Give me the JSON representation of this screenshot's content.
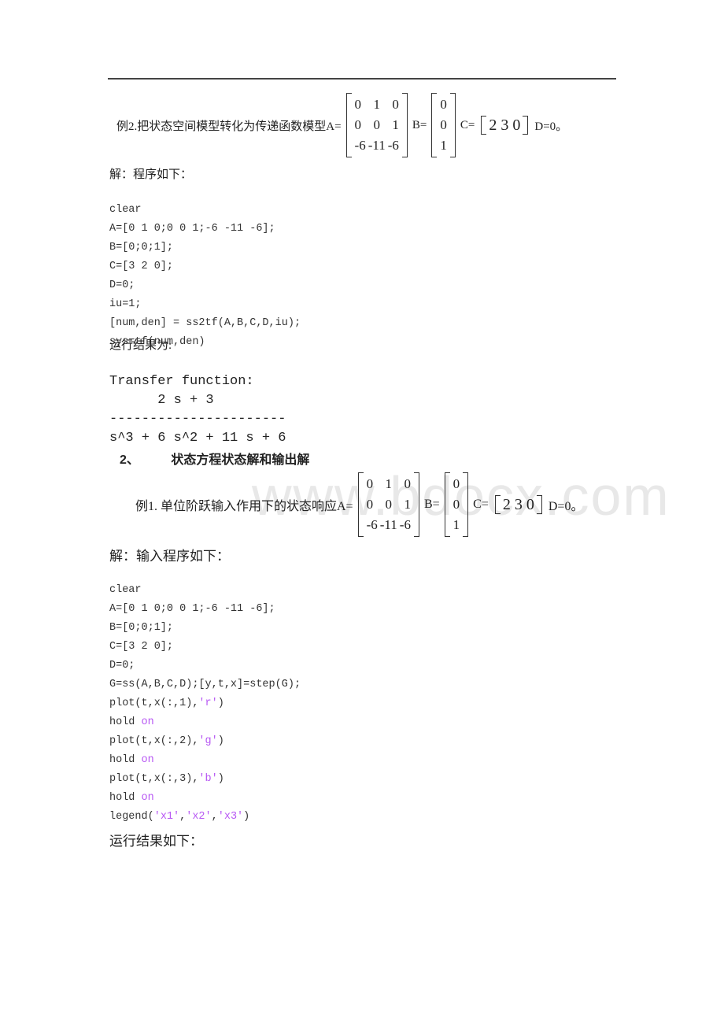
{
  "watermark": "www.bdocx.com",
  "example2": {
    "label": "例2.把状态空间模型转化为传递函数模型A=",
    "A": [
      [
        "0",
        "1",
        "0"
      ],
      [
        "0",
        "0",
        "1"
      ],
      [
        "-6",
        "-11",
        "-6"
      ]
    ],
    "B_label": "B=",
    "B": [
      "0",
      "0",
      "1"
    ],
    "C_label": "C=",
    "C": "2 3 0",
    "D_label": "D=0。"
  },
  "solution1": {
    "intro": "解：程序如下：",
    "code": [
      "clear",
      "A=[0 1 0;0 0 1;-6 -11 -6];",
      "B=[0;0;1];",
      "C=[3 2 0];",
      "D=0;",
      "iu=1;",
      "[num,den] = ss2tf(A,B,C,D,iu);",
      "sys=tf(num,den)"
    ],
    "result_label": "运行结果为:",
    "output": {
      "title": "Transfer function:",
      "numerator": "      2 s + 3",
      "divider": "----------------------",
      "denominator": "s^3 + 6 s^2 + 11 s + 6"
    }
  },
  "section2": {
    "number": "2、",
    "title": "状态方程状态解和输出解"
  },
  "example1": {
    "label": "例1. 单位阶跃输入作用下的状态响应A=",
    "A": [
      [
        "0",
        "1",
        "0"
      ],
      [
        "0",
        "0",
        "1"
      ],
      [
        "-6",
        "-11",
        "-6"
      ]
    ],
    "B_label": "B=",
    "B": [
      "0",
      "0",
      "1"
    ],
    "C_label": "C=",
    "C": "2 3 0",
    "D_label": "D=0。"
  },
  "solution2": {
    "intro": "解：输入程序如下：",
    "code_plain": [
      "clear",
      "A=[0 1 0;0 0 1;-6 -11 -6];",
      "B=[0;0;1];",
      "C=[3 2 0];",
      "D=0;",
      "G=ss(A,B,C,D);[y,t,x]=step(G);"
    ],
    "plot1": {
      "pre": "plot(t,x(:,1),",
      "str": "'r'",
      "post": ")"
    },
    "hold1": {
      "pre": "hold ",
      "str": "on"
    },
    "plot2": {
      "pre": "plot(t,x(:,2),",
      "str": "'g'",
      "post": ")"
    },
    "hold2": {
      "pre": "hold ",
      "str": "on"
    },
    "plot3": {
      "pre": "plot(t,x(:,3),",
      "str": "'b'",
      "post": ")"
    },
    "hold3": {
      "pre": "hold ",
      "str": "on"
    },
    "legend": {
      "pre": "legend(",
      "s1": "'x1'",
      "c1": ",",
      "s2": "'x2'",
      "c2": ",",
      "s3": "'x3'",
      "post": ")"
    },
    "result_label": "运行结果如下："
  }
}
